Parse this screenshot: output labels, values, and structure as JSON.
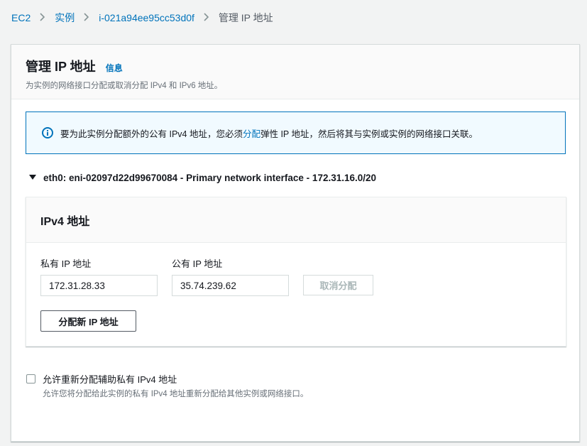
{
  "breadcrumb": {
    "items": [
      "EC2",
      "实例",
      "i-021a94ee95cc53d0f"
    ],
    "current": "管理 IP 地址"
  },
  "panel": {
    "title": "管理 IP 地址",
    "info_link": "信息",
    "description": "为实例的网络接口分配或取消分配 IPv4 和 IPv6 地址。"
  },
  "alert": {
    "icon": "info-circle-icon",
    "text_before": "要为此实例分配额外的公有 IPv4 地址，您必须",
    "link": "分配",
    "text_after": "弹性 IP 地址，然后将其与实例或实例的网络接口关联。"
  },
  "interface": {
    "expanded": true,
    "label": "eth0: eni-02097d22d99670084 - Primary network interface - 172.31.16.0/20"
  },
  "ipv4": {
    "heading": "IPv4 地址",
    "private_label": "私有 IP 地址",
    "private_value": "172.31.28.33",
    "public_label": "公有 IP 地址",
    "public_value": "35.74.239.62",
    "unassign_button": "取消分配",
    "assign_new_button": "分配新 IP 地址"
  },
  "reassign": {
    "checked": false,
    "label": "允许重新分配辅助私有 IPv4 地址",
    "description": "允许您将分配给此实例的私有 IPv4 地址重新分配给其他实例或网络接口。"
  },
  "colors": {
    "link": "#0073bb",
    "alert_bg": "#f1faff",
    "alert_border": "#0073bb",
    "page_bg": "#f2f3f3"
  }
}
